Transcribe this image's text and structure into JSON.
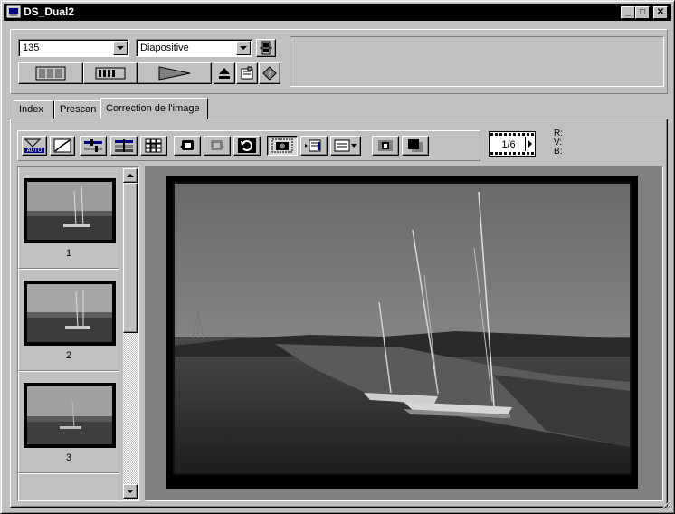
{
  "window": {
    "title": "DS_Dual2"
  },
  "titlebar_buttons": {
    "minimize": "_",
    "maximize": "□",
    "close": "✕"
  },
  "scan_settings": {
    "film_format": "135",
    "film_type": "Diapositive"
  },
  "tabs": [
    {
      "label": "Index",
      "active": false
    },
    {
      "label": "Prescan",
      "active": false
    },
    {
      "label": "Correction de l'image",
      "active": true
    }
  ],
  "frame_counter": "1/6",
  "rgb_readout": {
    "r_label": "R:",
    "g_label": "V:",
    "b_label": "B:"
  },
  "thumbnails": [
    {
      "number": "1"
    },
    {
      "number": "2"
    },
    {
      "number": "3"
    }
  ],
  "colors": {
    "titlebar": "#000000",
    "face": "#c0c0c0",
    "preview_bg": "#808080",
    "toolbar_icon_accent": "#000080"
  },
  "icons": {
    "toolbar_top": [
      "index-scan-icon",
      "prescan-icon",
      "scan-icon",
      "eject-icon",
      "preferences-icon",
      "help-icon"
    ],
    "correction_toolbar": [
      "auto-exposure-icon",
      "tone-curve-icon",
      "brightness-contrast-icon",
      "color-balance-icon",
      "variations-icon",
      "undo-icon",
      "redo-icon",
      "reset-icon",
      "crop-scan-icon",
      "jobs-icon",
      "settings-icon",
      "grain-dissolver-icon",
      "invert-icon"
    ]
  }
}
